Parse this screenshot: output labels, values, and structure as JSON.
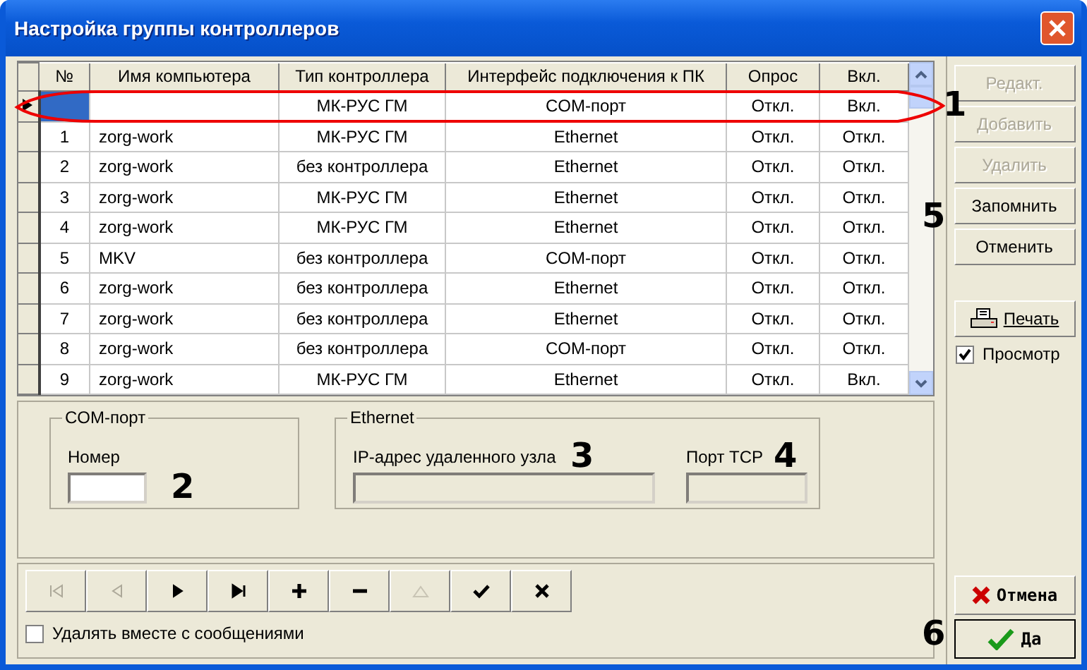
{
  "window": {
    "title": "Настройка группы контроллеров"
  },
  "table": {
    "columns": [
      "№",
      "Имя компьютера",
      "Тип контроллера",
      "Интерфейс подключения к ПК",
      "Опрос",
      "Вкл."
    ],
    "rows": [
      {
        "cells": [
          "",
          "",
          "МК-РУС ГМ",
          "COM-порт",
          "Откл.",
          "Вкл."
        ],
        "selected": true
      },
      {
        "cells": [
          "1",
          "zorg-work",
          "МК-РУС ГМ",
          "Ethernet",
          "Откл.",
          "Откл."
        ],
        "selected": false
      },
      {
        "cells": [
          "2",
          "zorg-work",
          "без контроллера",
          "Ethernet",
          "Откл.",
          "Откл."
        ],
        "selected": false
      },
      {
        "cells": [
          "3",
          "zorg-work",
          "МК-РУС ГМ",
          "Ethernet",
          "Откл.",
          "Откл."
        ],
        "selected": false
      },
      {
        "cells": [
          "4",
          "zorg-work",
          "МК-РУС ГМ",
          "Ethernet",
          "Откл.",
          "Откл."
        ],
        "selected": false
      },
      {
        "cells": [
          "5",
          "MKV",
          "без контроллера",
          "COM-порт",
          "Откл.",
          "Откл."
        ],
        "selected": false
      },
      {
        "cells": [
          "6",
          "zorg-work",
          "без контроллера",
          "Ethernet",
          "Откл.",
          "Откл."
        ],
        "selected": false
      },
      {
        "cells": [
          "7",
          "zorg-work",
          "без контроллера",
          "Ethernet",
          "Откл.",
          "Откл."
        ],
        "selected": false
      },
      {
        "cells": [
          "8",
          "zorg-work",
          "без контроллера",
          "COM-порт",
          "Откл.",
          "Откл."
        ],
        "selected": false
      },
      {
        "cells": [
          "9",
          "zorg-work",
          "МК-РУС ГМ",
          "Ethernet",
          "Откл.",
          "Вкл."
        ],
        "selected": false
      }
    ]
  },
  "com_group": {
    "title": "COM-порт",
    "fields": [
      {
        "label": "Номер",
        "disabled": false
      }
    ]
  },
  "ethernet_group": {
    "title": "Ethernet",
    "fields": [
      {
        "label": "IP-адрес удаленного узла",
        "disabled": true
      },
      {
        "label": "Порт TCP",
        "disabled": true
      }
    ]
  },
  "navigator": [
    {
      "kind": "first",
      "disabled": true
    },
    {
      "kind": "prev",
      "disabled": true
    },
    {
      "kind": "next",
      "disabled": false
    },
    {
      "kind": "last",
      "disabled": false
    },
    {
      "kind": "add",
      "disabled": false
    },
    {
      "kind": "delete",
      "disabled": false
    },
    {
      "kind": "edit",
      "disabled": true
    },
    {
      "kind": "post",
      "disabled": false
    },
    {
      "kind": "cancel",
      "disabled": false
    }
  ],
  "delete_with_messages": {
    "label": "Удалять вместе с сообщениями",
    "checked": false
  },
  "side_buttons": [
    {
      "label": "Редакт.",
      "disabled": true
    },
    {
      "label": "Добавить",
      "disabled": true
    },
    {
      "label": "Удалить",
      "disabled": true
    },
    {
      "label": "Запомнить",
      "disabled": false
    },
    {
      "label": "Отменить",
      "disabled": false
    }
  ],
  "print_button": {
    "label": "Печать"
  },
  "preview": {
    "label": "Просмотр",
    "checked": true
  },
  "cancel_button": {
    "label": "Отмена"
  },
  "ok_button": {
    "label": "Да"
  },
  "annotations": [
    {
      "label": "1"
    },
    {
      "label": "2"
    },
    {
      "label": "3"
    },
    {
      "label": "4"
    },
    {
      "label": "5"
    },
    {
      "label": "6"
    }
  ]
}
